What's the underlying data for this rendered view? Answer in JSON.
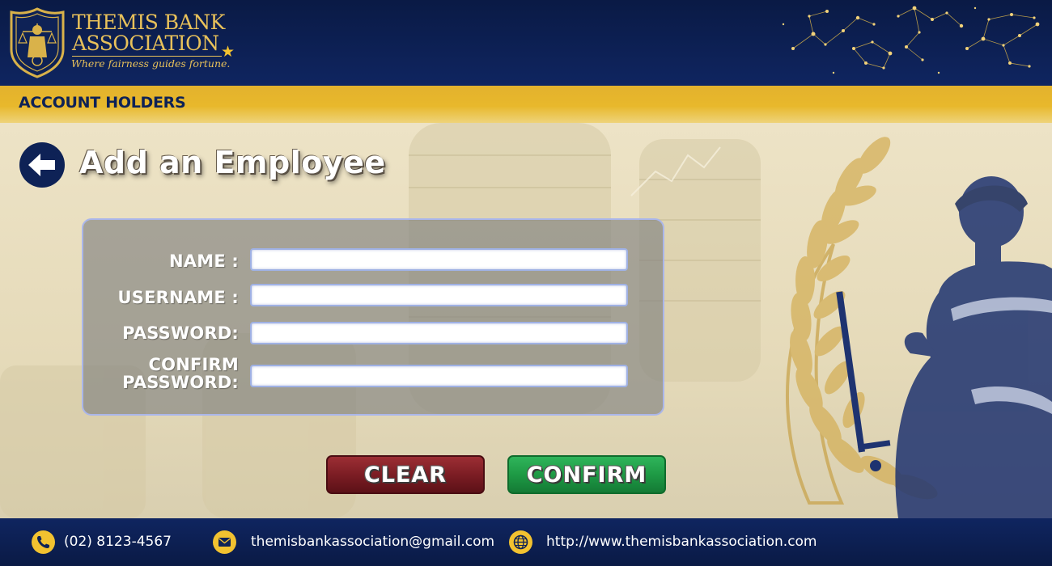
{
  "brand": {
    "name_line1": "THEMIS BANK",
    "name_line2": "ASSOCIATION",
    "tagline": "Where fairness guides fortune.",
    "logo_icon": "lady-justice-badge-icon"
  },
  "section": {
    "title": "ACCOUNT HOLDERS"
  },
  "page": {
    "title": "Add an Employee",
    "back_icon": "arrow-left-icon"
  },
  "form": {
    "fields": [
      {
        "label": "NAME :",
        "value": "",
        "placeholder": ""
      },
      {
        "label": "USERNAME :",
        "value": "",
        "placeholder": ""
      },
      {
        "label": "PASSWORD:",
        "value": "",
        "placeholder": ""
      },
      {
        "label_line1": "CONFIRM",
        "label_line2": "PASSWORD:",
        "value": "",
        "placeholder": ""
      }
    ]
  },
  "buttons": {
    "clear_label": "CLEAR",
    "confirm_label": "CONFIRM"
  },
  "footer": {
    "phone": "(02) 8123-4567",
    "email": "themisbankassociation@gmail.com",
    "website": "http://www.themisbankassociation.com"
  },
  "colors": {
    "navy": "#0e2256",
    "gold": "#e8b82c",
    "clear_red": "#7c1d24",
    "confirm_green": "#1e9a45",
    "panel_border": "#aab6ea"
  }
}
